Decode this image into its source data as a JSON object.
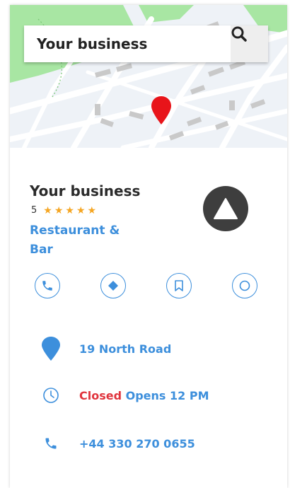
{
  "search": {
    "value": "Your business"
  },
  "business": {
    "name": "Your business",
    "rating": "5",
    "stars": [
      "★",
      "★",
      "★",
      "★",
      "★"
    ],
    "category": "Restaurant & Bar"
  },
  "actions": [
    {
      "icon": "phone-icon"
    },
    {
      "icon": "directions-icon"
    },
    {
      "icon": "bookmark-icon"
    },
    {
      "icon": "circle-icon"
    }
  ],
  "info": {
    "address": "19 North Road",
    "hours_status": "Closed",
    "hours_next": "Opens 12 PM",
    "phone": "+44 330 270 0655"
  },
  "colors": {
    "accent": "#3d8fdc",
    "closed": "#e0343d",
    "star": "#f5a623",
    "pin": "#e8141a"
  }
}
